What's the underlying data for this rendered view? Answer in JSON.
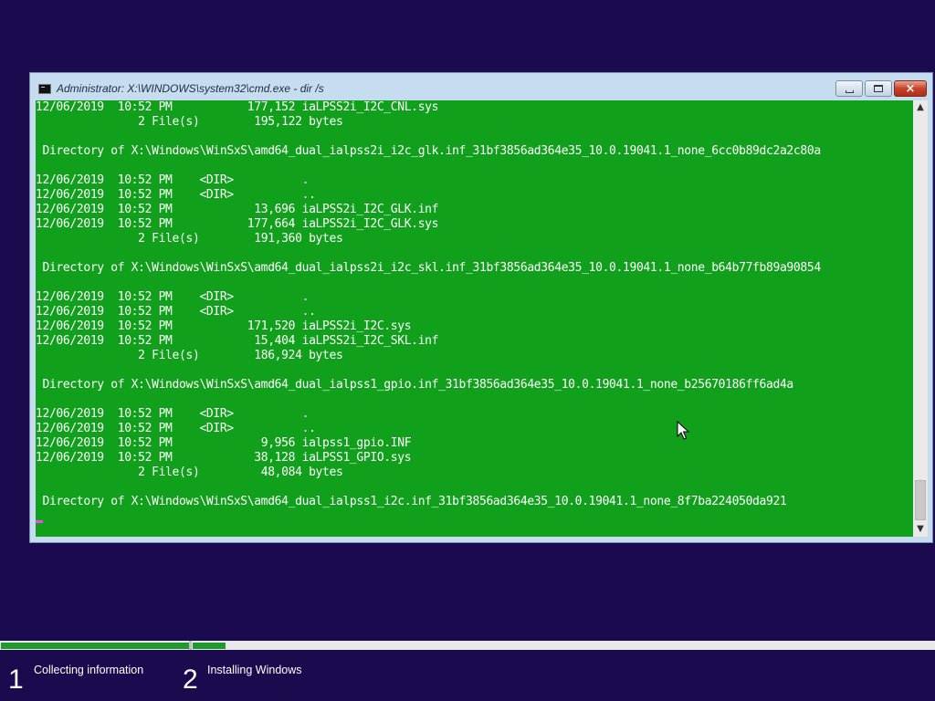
{
  "window": {
    "title": "Administrator: X:\\WINDOWS\\system32\\cmd.exe - dir /s",
    "icon": "console-icon",
    "controls": {
      "minimize": "minimize-icon",
      "maximize": "maximize-icon",
      "close": "×"
    }
  },
  "console": {
    "background": "#11a01c",
    "foreground": "#ffffff",
    "lines": [
      "12/06/2019  10:52 PM           177,152 iaLPSS2i_I2C_CNL.sys",
      "               2 File(s)        195,122 bytes",
      "",
      " Directory of X:\\Windows\\WinSxS\\amd64_dual_ialpss2i_i2c_glk.inf_31bf3856ad364e35_10.0.19041.1_none_6cc0b89dc2a2c80a",
      "",
      "12/06/2019  10:52 PM    <DIR>          .",
      "12/06/2019  10:52 PM    <DIR>          ..",
      "12/06/2019  10:52 PM            13,696 iaLPSS2i_I2C_GLK.inf",
      "12/06/2019  10:52 PM           177,664 iaLPSS2i_I2C_GLK.sys",
      "               2 File(s)        191,360 bytes",
      "",
      " Directory of X:\\Windows\\WinSxS\\amd64_dual_ialpss2i_i2c_skl.inf_31bf3856ad364e35_10.0.19041.1_none_b64b77fb89a90854",
      "",
      "12/06/2019  10:52 PM    <DIR>          .",
      "12/06/2019  10:52 PM    <DIR>          ..",
      "12/06/2019  10:52 PM           171,520 iaLPSS2i_I2C.sys",
      "12/06/2019  10:52 PM            15,404 iaLPSS2i_I2C_SKL.inf",
      "               2 File(s)        186,924 bytes",
      "",
      " Directory of X:\\Windows\\WinSxS\\amd64_dual_ialpss1_gpio.inf_31bf3856ad364e35_10.0.19041.1_none_b25670186ff6ad4a",
      "",
      "12/06/2019  10:52 PM    <DIR>          .",
      "12/06/2019  10:52 PM    <DIR>          ..",
      "12/06/2019  10:52 PM             9,956 ialpss1_gpio.INF",
      "12/06/2019  10:52 PM            38,128 iaLPSS1_GPIO.sys",
      "               2 File(s)         48,084 bytes",
      "",
      " Directory of X:\\Windows\\WinSxS\\amd64_dual_ialpss1_i2c.inf_31bf3856ad364e35_10.0.19041.1_none_8f7ba224050da921"
    ]
  },
  "setup_progress": {
    "accent": "#1e9b2c",
    "steps": [
      {
        "number": "1",
        "label": "Collecting information",
        "progress": 1.0
      },
      {
        "number": "2",
        "label": "Installing Windows",
        "progress": 0.045
      }
    ]
  }
}
